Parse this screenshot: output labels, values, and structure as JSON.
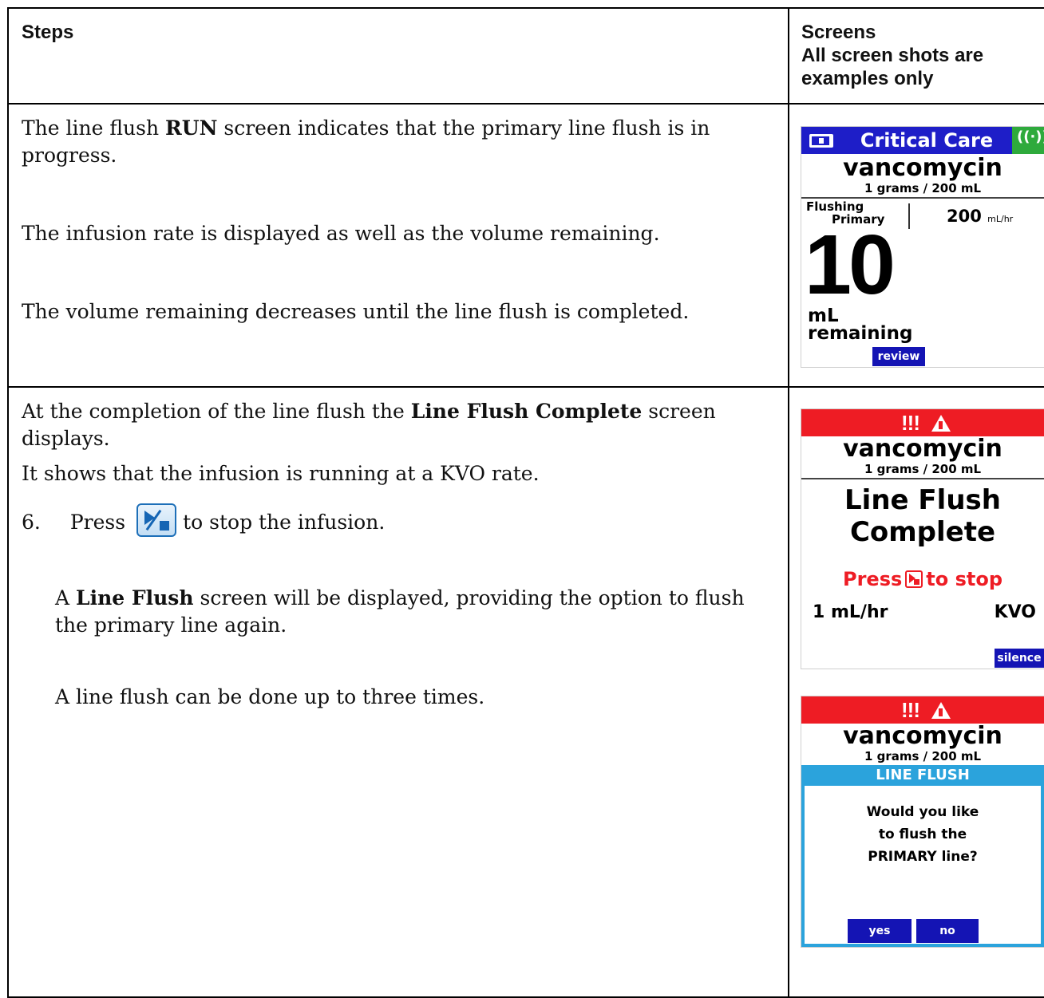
{
  "header": {
    "steps": "Steps",
    "screens_line1": "Screens",
    "screens_line2": "All screen shots are",
    "screens_line3": "examples only"
  },
  "row1": {
    "p1_pre": "The line flush ",
    "p1_bold": "RUN",
    "p1_post": " screen indicates that the primary line flush is in progress.",
    "p2": "The infusion rate is displayed as well as the volume remaining.",
    "p3": "The volume remaining decreases until the line flush is completed.",
    "screen": {
      "care_area": "Critical Care",
      "drug": "vancomycin",
      "concentration": "1 grams / 200 mL",
      "flushing": "Flushing",
      "primary": "Primary",
      "rate": "200",
      "rate_unit": "mL/hr",
      "volume": "10",
      "volume_unit": "mL",
      "volume_label": "remaining",
      "review_button": "review",
      "icons": [
        "battery-icon",
        "wireless-icon"
      ],
      "colors": {
        "header": "#1e1ec8",
        "wireless": "#2eaa3c",
        "button": "#1414b4"
      }
    }
  },
  "row2": {
    "p1_pre": "At the completion of the line flush the ",
    "p1_bold": "Line Flush Complete",
    "p1_post": " screen displays.",
    "p2": "It shows that the infusion is running at a KVO rate.",
    "step_number": "6.",
    "step_press": "Press",
    "step_post": "to stop the infusion.",
    "p3_pre": "A ",
    "p3_bold": "Line Flush",
    "p3_post": " screen will be displayed, providing the option to flush the primary line again.",
    "p4": "A line flush can be done up to three times.",
    "screen_complete": {
      "alert": "!!!",
      "drug": "vancomycin",
      "concentration": "1 grams / 200 mL",
      "title_line1": "Line Flush",
      "title_line2": "Complete",
      "press_pre": "Press",
      "press_post": "to stop",
      "rate": "1 mL/hr",
      "mode": "KVO",
      "silence_button": "silence",
      "colors": {
        "alert": "#ee1c24",
        "button": "#1414b4"
      }
    },
    "screen_prompt": {
      "alert": "!!!",
      "drug": "vancomycin",
      "concentration": "1 grams / 200 mL",
      "dialog_title": "LINE FLUSH",
      "question_line1": "Would you like",
      "question_line2": "to flush the",
      "question_line3": "PRIMARY line?",
      "yes_button": "yes",
      "no_button": "no",
      "colors": {
        "alert": "#ee1c24",
        "dialog": "#2ba3dc",
        "button": "#1414b4"
      }
    }
  }
}
